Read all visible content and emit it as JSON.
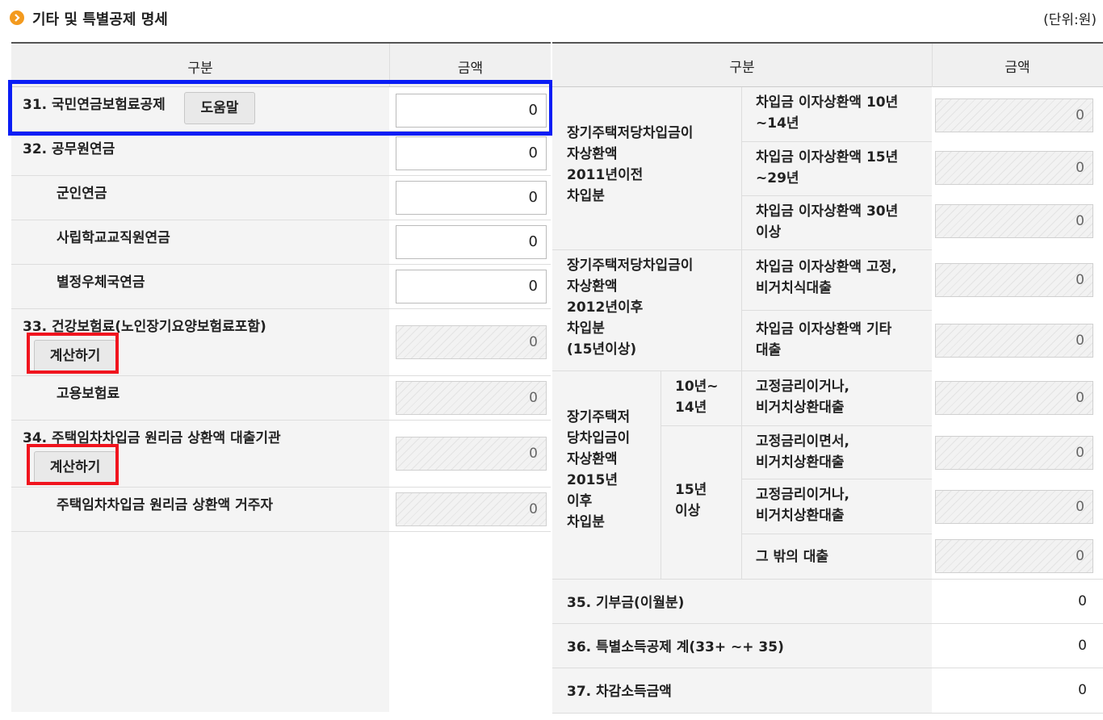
{
  "header": {
    "title": "기타 및 특별공제 명세",
    "unit": "(단위:원)"
  },
  "left": {
    "head_label": "구분",
    "head_amount": "금액",
    "rows": [
      {
        "label": "31. 국민연금보험료공제",
        "value": "0",
        "button": "도움말"
      },
      {
        "label": "32. 공무원연금",
        "value": "0"
      },
      {
        "label": "군인연금",
        "value": "0"
      },
      {
        "label": "사립학교교직원연금",
        "value": "0"
      },
      {
        "label": "별정우체국연금",
        "value": "0"
      },
      {
        "label": "33. 건강보험료(노인장기요양보험료포함)",
        "value": "0",
        "button": "계산하기"
      },
      {
        "label": "고용보험료",
        "value": "0"
      },
      {
        "label": "34. 주택임차차입금 원리금 상환액 대출기관",
        "value": "0",
        "button": "계산하기"
      },
      {
        "label": "주택임차차입금 원리금 상환액 거주자",
        "value": "0"
      }
    ]
  },
  "right": {
    "head_label": "구분",
    "head_amount": "금액",
    "group1": {
      "label": "장기주택저당차입금이\n자상환액\n2011년이전\n차입분",
      "items": [
        {
          "label": "차입금 이자상환액 10년\n~14년",
          "value": "0"
        },
        {
          "label": "차입금 이자상환액 15년\n~29년",
          "value": "0"
        },
        {
          "label": "차입금 이자상환액 30년\n이상",
          "value": "0"
        }
      ]
    },
    "group2": {
      "label": "장기주택저당차입금이\n자상환액\n2012년이후\n차입분\n(15년이상)",
      "items": [
        {
          "label": "차입금 이자상환액 고정,\n비거치식대출",
          "value": "0"
        },
        {
          "label": "차입금 이자상환액 기타\n대출",
          "value": "0"
        }
      ]
    },
    "group3": {
      "label": "장기주택저\n당차입금이\n자상환액\n2015년\n이후\n차입분",
      "sub1": "10년~\n14년",
      "sub2": "15년\n이상",
      "items": [
        {
          "label": "고정금리이거나,\n비거치상환대출",
          "value": "0"
        },
        {
          "label": "고정금리이면서,\n비거치상환대출",
          "value": "0"
        },
        {
          "label": "고정금리이거나,\n비거치상환대출",
          "value": "0"
        },
        {
          "label": "그 밖의 대출",
          "value": "0"
        }
      ]
    },
    "summary": [
      {
        "label": "35. 기부금(이월분)",
        "value": "0"
      },
      {
        "label": "36. 특별소득공제 계(33+ ~+ 35)",
        "value": "0"
      },
      {
        "label": "37. 차감소득금액",
        "value": "0"
      }
    ]
  }
}
